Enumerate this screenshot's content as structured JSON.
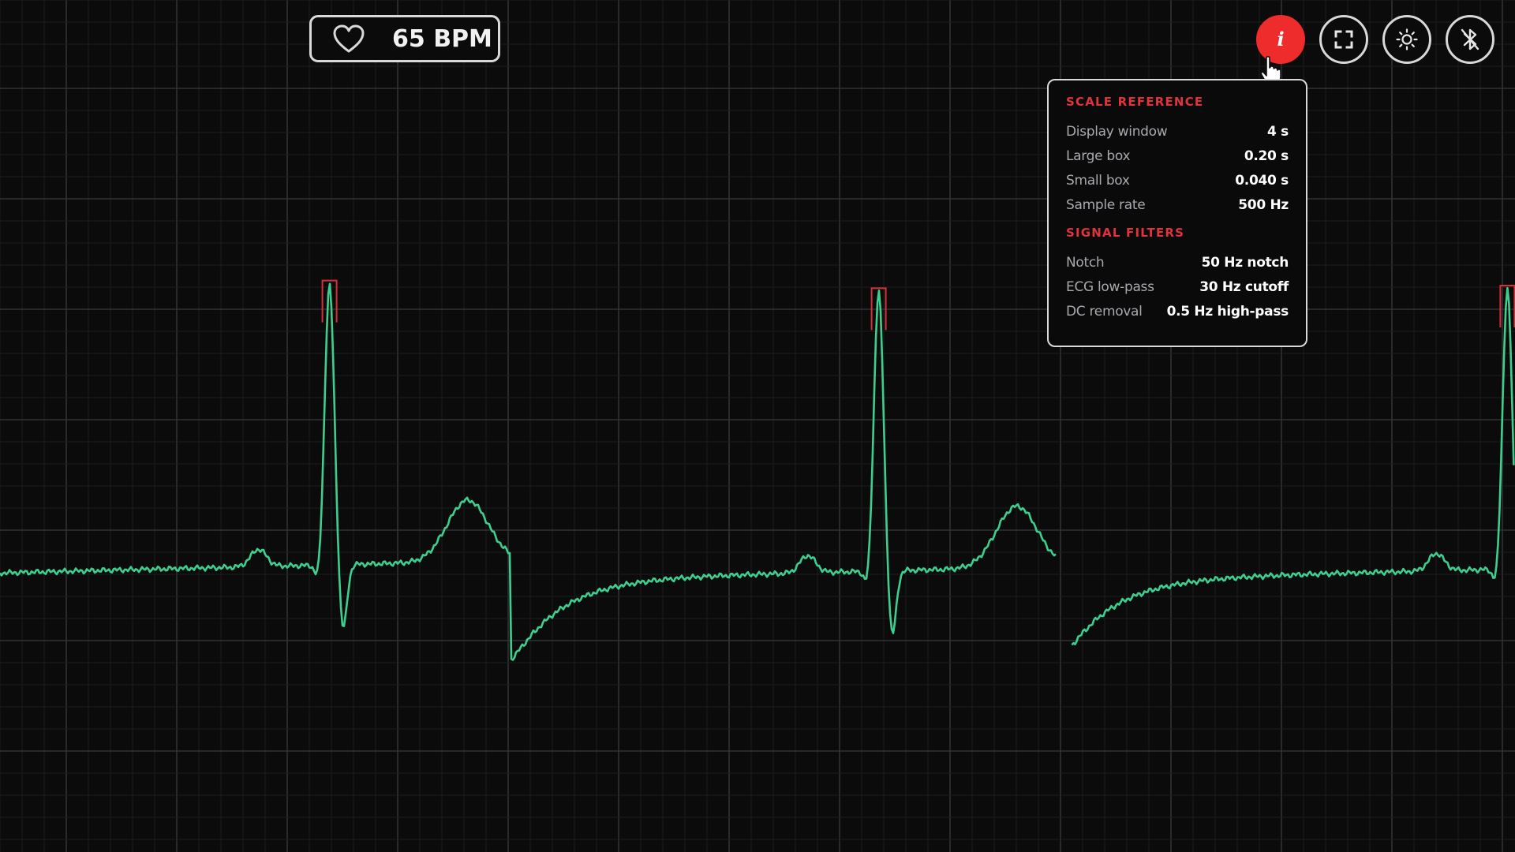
{
  "bpm": {
    "value_label": "65 BPM",
    "icon": "heart-icon"
  },
  "toolbar": {
    "buttons": [
      {
        "name": "info",
        "glyph": "i",
        "icon": "info-icon",
        "active": true
      },
      {
        "name": "fullscreen",
        "icon": "fullscreen-icon"
      },
      {
        "name": "brightness",
        "icon": "sun-icon"
      },
      {
        "name": "bluetooth-off",
        "icon": "bluetooth-off-icon"
      }
    ]
  },
  "info_panel": {
    "scale_title": "SCALE REFERENCE",
    "scale_rows": [
      {
        "label": "Display window",
        "value": "4 s"
      },
      {
        "label": "Large box",
        "value": "0.20 s"
      },
      {
        "label": "Small box",
        "value": "0.040 s"
      },
      {
        "label": "Sample rate",
        "value": "500 Hz"
      }
    ],
    "filters_title": "SIGNAL FILTERS",
    "filter_rows": [
      {
        "label": "Notch",
        "value": "50 Hz notch"
      },
      {
        "label": "ECG low-pass",
        "value": "30 Hz cutoff"
      },
      {
        "label": "DC removal",
        "value": "0.5 Hz high-pass"
      }
    ]
  },
  "colors": {
    "background": "#0b0b0c",
    "grid": "#2a2a2c",
    "trace": "#3ecf8e",
    "peak_marker": "#d4303a",
    "accent": "#ee2c2c"
  },
  "chart_data": {
    "type": "line",
    "title": "",
    "window_seconds": 4,
    "bpm": 65,
    "grid": true,
    "r_peak_times_s": [
      0.87,
      2.32,
      3.98
    ],
    "baseline_gap_s": [
      2.79,
      2.83
    ]
  }
}
